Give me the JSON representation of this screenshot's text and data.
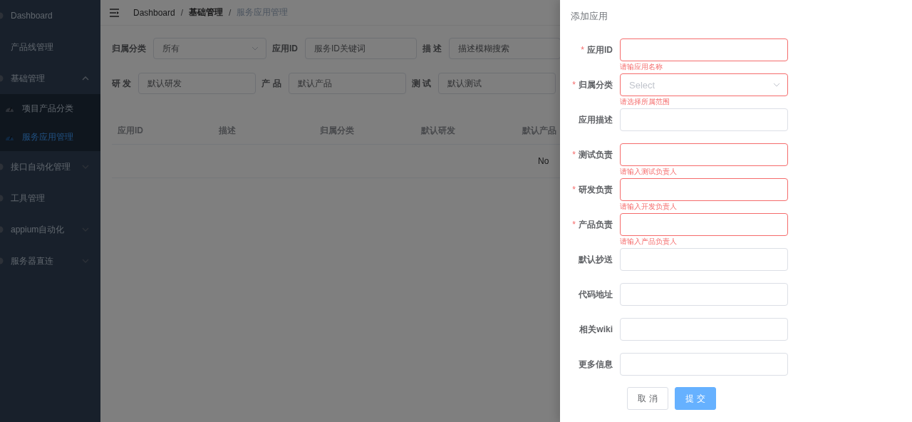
{
  "sidebar": {
    "items": [
      {
        "label": "Dashboard",
        "selected": false
      },
      {
        "label": "产品线管理",
        "selected": false,
        "no_icon": true
      },
      {
        "label": "基础管理",
        "selected": false,
        "expanded": true,
        "children": [
          {
            "label": "项目产品分类",
            "selected": false
          },
          {
            "label": "服务应用管理",
            "selected": true
          }
        ]
      },
      {
        "label": "接口自动化管理",
        "selected": false,
        "expanded": false
      },
      {
        "label": "工具管理",
        "selected": false
      },
      {
        "label": "appium自动化",
        "selected": false,
        "expanded": false
      },
      {
        "label": "服务器直连",
        "selected": false,
        "expanded": false
      }
    ]
  },
  "breadcrumb": [
    "Dashboard",
    "基础管理",
    "服务应用管理"
  ],
  "breadcrumb_separator": "/",
  "filters": [
    [
      {
        "label": "归属分类",
        "kind": "select",
        "value": "所有"
      },
      {
        "label": "应用ID",
        "kind": "input",
        "placeholder": "服务ID关键词"
      },
      {
        "label": "描 述",
        "kind": "input",
        "placeholder": "描述模糊搜索"
      }
    ],
    [
      {
        "label": "研 发",
        "kind": "input",
        "placeholder": "默认研发"
      },
      {
        "label": "产 品",
        "kind": "input",
        "placeholder": "默认产品"
      },
      {
        "label": "测 试",
        "kind": "input",
        "placeholder": "默认测试"
      }
    ]
  ],
  "table": {
    "columns": [
      "应用ID",
      "描述",
      "归属分类",
      "默认研发",
      "默认产品"
    ],
    "empty_text": "No"
  },
  "drawer": {
    "title": "添加应用",
    "required_mark": "*",
    "fields": [
      {
        "label": "应用ID",
        "kind": "input",
        "required": true,
        "error": "请输应用名称"
      },
      {
        "label": "归属分类",
        "kind": "select",
        "required": true,
        "placeholder": "Select",
        "error": "请选择所属范围"
      },
      {
        "label": "应用描述",
        "kind": "input",
        "required": false
      },
      {
        "label": "测试负责",
        "kind": "input",
        "required": true,
        "error": "请输入测试负责人"
      },
      {
        "label": "研发负责",
        "kind": "input",
        "required": true,
        "error": "请输入开发负责人"
      },
      {
        "label": "产品负责",
        "kind": "input",
        "required": true,
        "error": "请输入产品负责人"
      },
      {
        "label": "默认抄送",
        "kind": "input",
        "required": false
      },
      {
        "label": "代码地址",
        "kind": "input",
        "required": false
      },
      {
        "label": "相关wiki",
        "kind": "input",
        "required": false
      },
      {
        "label": "更多信息",
        "kind": "input",
        "required": false
      }
    ],
    "buttons": [
      {
        "label": "取 消",
        "kind": "default"
      },
      {
        "label": "提 交",
        "kind": "primary"
      }
    ]
  }
}
